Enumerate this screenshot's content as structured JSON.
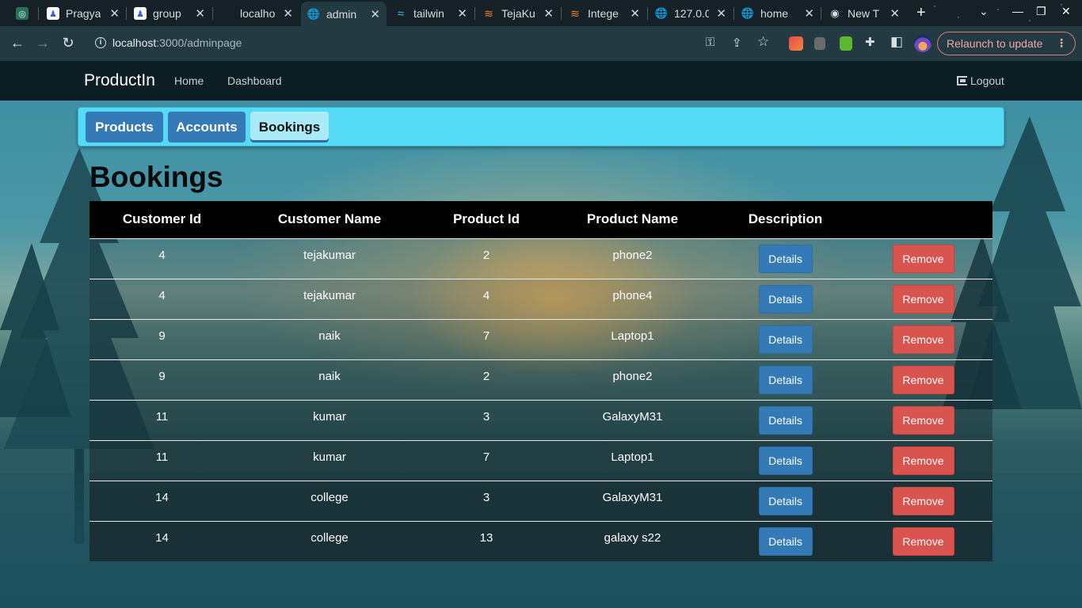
{
  "browser": {
    "tabs": [
      {
        "label": "",
        "fav_color": "#2e6e5c",
        "fav_glyph": "◎"
      },
      {
        "label": "Pragya",
        "fav_color": "#ffffff",
        "fav_glyph": "♟"
      },
      {
        "label": "group",
        "fav_color": "#ffffff",
        "fav_glyph": "♟"
      },
      {
        "label": "localho",
        "fav_color": "",
        "fav_glyph": ""
      },
      {
        "label": "admin",
        "fav_color": "#dfe6e9",
        "fav_glyph": "🌐"
      },
      {
        "label": "tailwin",
        "fav_color": "",
        "fav_glyph": "≈"
      },
      {
        "label": "TejaKu",
        "fav_color": "",
        "fav_glyph": "≋"
      },
      {
        "label": "Intege",
        "fav_color": "",
        "fav_glyph": "≋"
      },
      {
        "label": "127.0.0",
        "fav_color": "",
        "fav_glyph": "🌐"
      },
      {
        "label": "home",
        "fav_color": "",
        "fav_glyph": "🌐"
      },
      {
        "label": "New T",
        "fav_color": "",
        "fav_glyph": "◉"
      }
    ],
    "url_host": "localhost",
    "url_path": ":3000/adminpage",
    "relaunch_label": "Relaunch to update",
    "close_glyph": "✕",
    "new_tab_glyph": "+",
    "tab_search_glyph": "⌄",
    "back_glyph": "←",
    "forward_glyph": "→",
    "reload_glyph": "↻",
    "info_glyph": "i",
    "key_glyph": "⚿",
    "share_glyph": "⇪",
    "star_glyph": "☆",
    "puzzle_glyph": "✚",
    "sidepanel_glyph": "◧",
    "menu_glyph": "⋮",
    "minimize_glyph": "—",
    "restore_glyph": "❐",
    "close_window_glyph": "✕"
  },
  "site": {
    "brand": "ProductIn",
    "nav": [
      "Home",
      "Dashboard"
    ],
    "logout": "Logout"
  },
  "panel_tabs": [
    "Products",
    "Accounts",
    "Bookings"
  ],
  "active_tab": "Bookings",
  "heading": "Bookings",
  "table": {
    "columns": [
      "Customer Id",
      "Customer Name",
      "Product Id",
      "Product Name",
      "Description",
      ""
    ],
    "details_label": "Details",
    "remove_label": "Remove",
    "rows": [
      {
        "customer_id": "4",
        "customer_name": "tejakumar",
        "product_id": "2",
        "product_name": "phone2"
      },
      {
        "customer_id": "4",
        "customer_name": "tejakumar",
        "product_id": "4",
        "product_name": "phone4"
      },
      {
        "customer_id": "9",
        "customer_name": "naik",
        "product_id": "7",
        "product_name": "Laptop1"
      },
      {
        "customer_id": "9",
        "customer_name": "naik",
        "product_id": "2",
        "product_name": "phone2"
      },
      {
        "customer_id": "11",
        "customer_name": "kumar",
        "product_id": "3",
        "product_name": "GalaxyM31"
      },
      {
        "customer_id": "11",
        "customer_name": "kumar",
        "product_id": "7",
        "product_name": "Laptop1"
      },
      {
        "customer_id": "14",
        "customer_name": "college",
        "product_id": "3",
        "product_name": "GalaxyM31"
      },
      {
        "customer_id": "14",
        "customer_name": "college",
        "product_id": "13",
        "product_name": "galaxy s22"
      }
    ]
  },
  "colors": {
    "primary": "#337ab7",
    "danger": "#d9534f",
    "panel": "#56dbf7",
    "navbar": "#0c1d23"
  }
}
